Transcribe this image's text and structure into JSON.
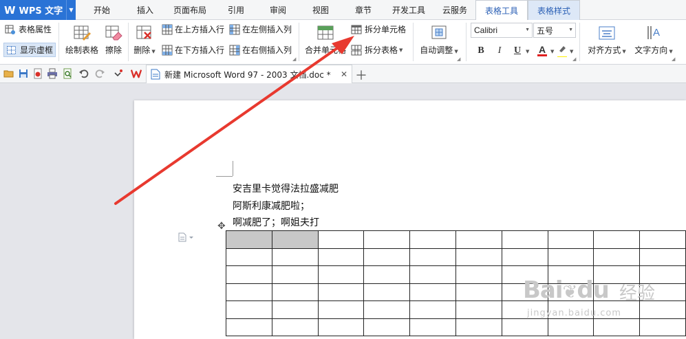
{
  "app": {
    "logo": "W",
    "name": "WPS 文字"
  },
  "tabs": [
    {
      "label": "开始"
    },
    {
      "label": "插入"
    },
    {
      "label": "页面布局"
    },
    {
      "label": "引用"
    },
    {
      "label": "审阅"
    },
    {
      "label": "视图"
    },
    {
      "label": "章节"
    },
    {
      "label": "开发工具"
    },
    {
      "label": "云服务"
    },
    {
      "label": "表格工具"
    },
    {
      "label": "表格样式"
    }
  ],
  "ribbon": {
    "table_properties": "表格属性",
    "show_gridlines": "显示虚框",
    "draw_table": "绘制表格",
    "erase": "擦除",
    "delete": "删除",
    "insert_row_above": "在上方插入行",
    "insert_row_below": "在下方插入行",
    "insert_col_left": "在左侧插入列",
    "insert_col_right": "在右侧插入列",
    "merge_cells": "合并单元格",
    "split_cells": "拆分单元格",
    "split_table": "拆分表格",
    "auto_fit": "自动调整",
    "font_name": "Calibri",
    "font_size": "五号",
    "bold": "B",
    "italic": "I",
    "underline": "U",
    "font_color": "A",
    "align": "对齐方式",
    "text_direction": "文字方向"
  },
  "document_tab": {
    "title": "新建 Microsoft Word 97 - 2003 文档.doc *"
  },
  "document": {
    "lines": [
      "安吉里卡觉得法拉盛减肥",
      "阿斯利康减肥啦；",
      "啊减肥了；啊姐夫打"
    ]
  },
  "watermark": {
    "brand": "Bai",
    "brand2": "du",
    "cn": "经验",
    "url": "jingyan.baidu.com"
  },
  "colors": {
    "app_blue": "#2a73d6",
    "active_tab_text": "#2a5fb5",
    "font_color_bar": "#e02020",
    "highlight_bar": "#ffee00",
    "annotation_arrow": "#e8392f",
    "shaded_cell": "#c8c8c8"
  }
}
